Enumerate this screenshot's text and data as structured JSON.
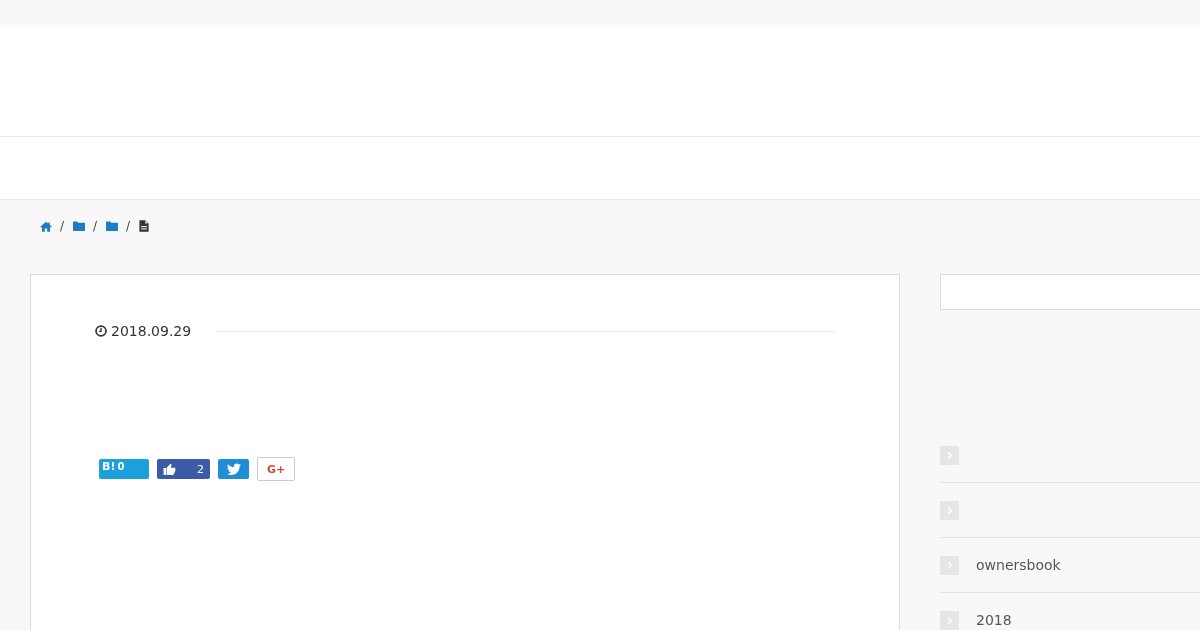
{
  "breadcrumb": {
    "separator": "/",
    "items": [
      {
        "kind": "home"
      },
      {
        "kind": "folder"
      },
      {
        "kind": "folder"
      },
      {
        "kind": "page"
      }
    ]
  },
  "post": {
    "date": "2018.09.29",
    "share_buttons": [
      {
        "kind": "bookmark",
        "label": "B!",
        "count": "0"
      },
      {
        "kind": "like",
        "count": "2"
      },
      {
        "kind": "tweet"
      },
      {
        "kind": "plus",
        "label": "G+"
      }
    ]
  },
  "sidebar": {
    "links": [
      {
        "kind": "blank"
      },
      {
        "kind": "blank"
      },
      {
        "kind": "text",
        "label": "ownersbook"
      },
      {
        "kind": "text",
        "label": "2018"
      }
    ]
  }
}
